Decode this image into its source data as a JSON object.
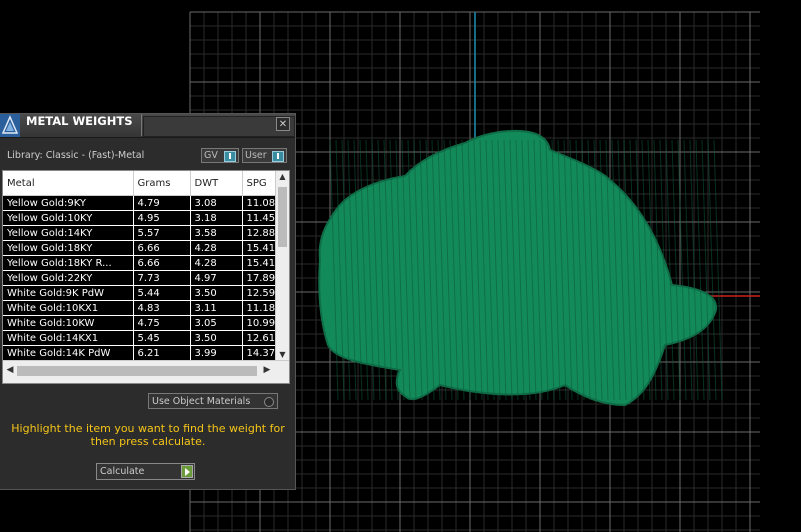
{
  "panel": {
    "title": "METAL WEIGHTS",
    "close_symbol": "✕",
    "library_label": "Library: Classic - (Fast)-Metal",
    "toggles": {
      "gv_label": "GV",
      "user_label": "User"
    },
    "columns": [
      "Metal",
      "Grams",
      "DWT",
      "SPG"
    ],
    "rows": [
      [
        "Yellow Gold:9KY",
        "4.79",
        "3.08",
        "11.08"
      ],
      [
        "Yellow Gold:10KY",
        "4.95",
        "3.18",
        "11.45"
      ],
      [
        "Yellow Gold:14KY",
        "5.57",
        "3.58",
        "12.88"
      ],
      [
        "Yellow Gold:18KY",
        "6.66",
        "4.28",
        "15.41"
      ],
      [
        "Yellow Gold:18KY R...",
        "6.66",
        "4.28",
        "15.41"
      ],
      [
        "Yellow Gold:22KY",
        "7.73",
        "4.97",
        "17.89"
      ],
      [
        "White Gold:9K PdW",
        "5.44",
        "3.50",
        "12.59"
      ],
      [
        "White Gold:10KX1",
        "4.83",
        "3.11",
        "11.18"
      ],
      [
        "White Gold:10KW",
        "4.75",
        "3.05",
        "10.99"
      ],
      [
        "White Gold:14KX1",
        "5.45",
        "3.50",
        "12.61"
      ],
      [
        "White Gold:14K PdW",
        "6.21",
        "3.99",
        "14.37"
      ]
    ],
    "use_object_materials_label": "Use Object Materials",
    "help_text": "Highlight the item you want to find the weight for then press calculate.",
    "calculate_label": "Calculate"
  },
  "colors": {
    "mesh": "#138a5a",
    "help_text": "#f5c518",
    "axis_y": "#1e8fb0",
    "axis_x": "#cc1f1f"
  }
}
